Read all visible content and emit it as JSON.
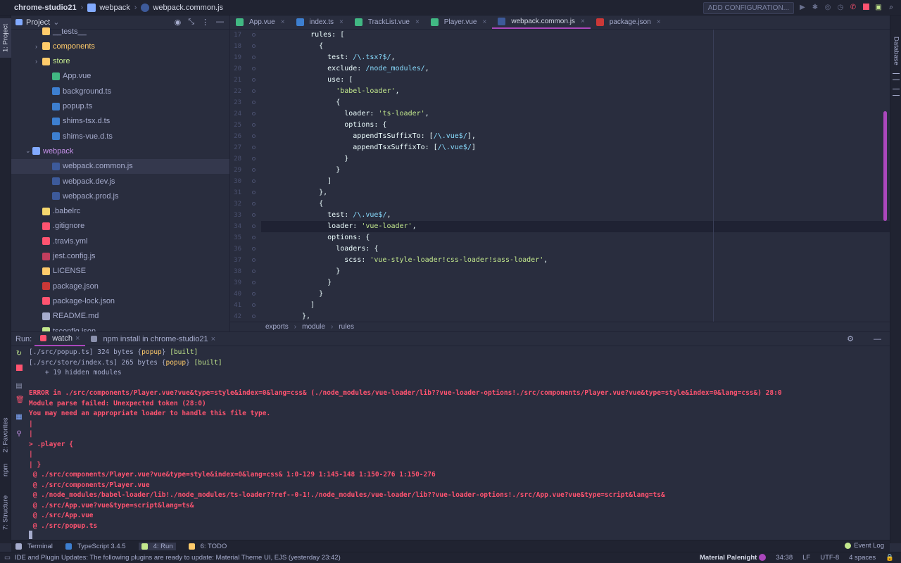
{
  "titlebar": {
    "project": "chrome-studio21",
    "folder": "webpack",
    "file": "webpack.common.js",
    "add_configuration": "ADD CONFIGURATION..."
  },
  "left_strip": {
    "project_tab": "1: Project",
    "favorites_tab": "2: Favorites",
    "npm_tab": "npm",
    "structure_tab": "7: Structure"
  },
  "right_strip": {
    "database_tab": "Database"
  },
  "project_panel": {
    "title": "Project",
    "items": [
      {
        "label": "__tests__",
        "indent": 2,
        "type": "folder",
        "arrow": "",
        "color": "#a6accd"
      },
      {
        "label": "components",
        "indent": 2,
        "type": "folder",
        "arrow": "›",
        "color": "#ffcb6b"
      },
      {
        "label": "store",
        "indent": 2,
        "type": "folder",
        "arrow": "›",
        "color": "#c3e88d"
      },
      {
        "label": "App.vue",
        "indent": 3,
        "type": "vue",
        "arrow": "",
        "color": "#a6accd"
      },
      {
        "label": "background.ts",
        "indent": 3,
        "type": "ts",
        "arrow": "",
        "color": "#a6accd"
      },
      {
        "label": "popup.ts",
        "indent": 3,
        "type": "ts",
        "arrow": "",
        "color": "#a6accd"
      },
      {
        "label": "shims-tsx.d.ts",
        "indent": 3,
        "type": "ts",
        "arrow": "",
        "color": "#a6accd"
      },
      {
        "label": "shims-vue.d.ts",
        "indent": 3,
        "type": "ts",
        "arrow": "",
        "color": "#a6accd"
      },
      {
        "label": "webpack",
        "indent": 1,
        "type": "folder-open",
        "arrow": "⌄",
        "color": "#c792ea"
      },
      {
        "label": "webpack.common.js",
        "indent": 3,
        "type": "js",
        "arrow": "",
        "color": "#a6accd",
        "selected": true
      },
      {
        "label": "webpack.dev.js",
        "indent": 3,
        "type": "js",
        "arrow": "",
        "color": "#a6accd"
      },
      {
        "label": "webpack.prod.js",
        "indent": 3,
        "type": "js",
        "arrow": "",
        "color": "#a6accd"
      },
      {
        "label": ".babelrc",
        "indent": 2,
        "type": "babel",
        "arrow": "",
        "color": "#a6accd"
      },
      {
        "label": ".gitignore",
        "indent": 2,
        "type": "git",
        "arrow": "",
        "color": "#a6accd"
      },
      {
        "label": ".travis.yml",
        "indent": 2,
        "type": "yml",
        "arrow": "",
        "color": "#a6accd"
      },
      {
        "label": "jest.config.js",
        "indent": 2,
        "type": "jest",
        "arrow": "",
        "color": "#a6accd"
      },
      {
        "label": "LICENSE",
        "indent": 2,
        "type": "license",
        "arrow": "",
        "color": "#a6accd"
      },
      {
        "label": "package.json",
        "indent": 2,
        "type": "npm",
        "arrow": "",
        "color": "#a6accd"
      },
      {
        "label": "package-lock.json",
        "indent": 2,
        "type": "lock",
        "arrow": "",
        "color": "#a6accd"
      },
      {
        "label": "README.md",
        "indent": 2,
        "type": "md",
        "arrow": "",
        "color": "#a6accd"
      },
      {
        "label": "tsconfig.json",
        "indent": 2,
        "type": "json",
        "arrow": "",
        "color": "#a6accd"
      }
    ]
  },
  "editor": {
    "tabs": [
      {
        "label": "App.vue",
        "icon": "vue",
        "active": false
      },
      {
        "label": "index.ts",
        "icon": "ts",
        "active": false
      },
      {
        "label": "TrackList.vue",
        "icon": "vue",
        "active": false
      },
      {
        "label": "Player.vue",
        "icon": "vue",
        "active": false
      },
      {
        "label": "webpack.common.js",
        "icon": "js",
        "active": true
      },
      {
        "label": "package.json",
        "icon": "npm",
        "active": false
      }
    ],
    "lines": [
      {
        "n": "17",
        "t": "    rules: ["
      },
      {
        "n": "18",
        "t": "      {"
      },
      {
        "n": "19",
        "t": "        test: /\\.tsx?$/,"
      },
      {
        "n": "20",
        "t": "        exclude: /node_modules/,"
      },
      {
        "n": "21",
        "t": "        use: ["
      },
      {
        "n": "22",
        "t": "          'babel-loader',"
      },
      {
        "n": "23",
        "t": "          {"
      },
      {
        "n": "24",
        "t": "            loader: 'ts-loader',"
      },
      {
        "n": "25",
        "t": "            options: {"
      },
      {
        "n": "26",
        "t": "              appendTsSuffixTo: [/\\.vue$/],"
      },
      {
        "n": "27",
        "t": "              appendTsxSuffixTo: [/\\.vue$/]"
      },
      {
        "n": "28",
        "t": "            }"
      },
      {
        "n": "29",
        "t": "          }"
      },
      {
        "n": "30",
        "t": "        ]"
      },
      {
        "n": "31",
        "t": "      },"
      },
      {
        "n": "32",
        "t": "      {"
      },
      {
        "n": "33",
        "t": "        test: /\\.vue$/,"
      },
      {
        "n": "34",
        "t": "        loader: 'vue-loader',",
        "current": true
      },
      {
        "n": "35",
        "t": "        options: {"
      },
      {
        "n": "36",
        "t": "          loaders: {"
      },
      {
        "n": "37",
        "t": "            scss: 'vue-style-loader!css-loader!sass-loader',"
      },
      {
        "n": "38",
        "t": "          }"
      },
      {
        "n": "39",
        "t": "        }"
      },
      {
        "n": "40",
        "t": "      }"
      },
      {
        "n": "41",
        "t": "    ]"
      },
      {
        "n": "42",
        "t": "  },"
      }
    ],
    "breadcrumb": [
      "exports",
      "module",
      "rules"
    ]
  },
  "run": {
    "label": "Run:",
    "tabs": [
      {
        "label": "watch",
        "active": true
      },
      {
        "label": "npm install in chrome-studio21",
        "active": false
      }
    ],
    "console": [
      {
        "parts": [
          {
            "t": "[./src/popup.ts] 324 bytes {",
            "c": "wh"
          },
          {
            "t": "popup",
            "c": "yl"
          },
          {
            "t": "} ",
            "c": "wh"
          },
          {
            "t": "[built]",
            "c": "gr"
          }
        ]
      },
      {
        "parts": [
          {
            "t": "[./src/store/index.ts] 265 bytes {",
            "c": "wh"
          },
          {
            "t": "popup",
            "c": "yl"
          },
          {
            "t": "} ",
            "c": "wh"
          },
          {
            "t": "[built]",
            "c": "gr"
          }
        ]
      },
      {
        "parts": [
          {
            "t": "    + 19 hidden modules",
            "c": "wh"
          }
        ]
      },
      {
        "parts": [
          {
            "t": "",
            "c": "wh"
          }
        ]
      },
      {
        "parts": [
          {
            "t": "ERROR in ./src/components/Player.vue?vue&type=style&index=0&lang=css& (./node_modules/vue-loader/lib??vue-loader-options!./src/components/Player.vue?vue&type=style&index=0&lang=css&) 28:0",
            "c": "err"
          }
        ]
      },
      {
        "parts": [
          {
            "t": "Module parse failed: Unexpected token (28:0)",
            "c": "err"
          }
        ]
      },
      {
        "parts": [
          {
            "t": "You may need an appropriate loader to handle this file type.",
            "c": "err"
          }
        ]
      },
      {
        "parts": [
          {
            "t": "|",
            "c": "err"
          }
        ]
      },
      {
        "parts": [
          {
            "t": "|",
            "c": "err"
          }
        ]
      },
      {
        "parts": [
          {
            "t": "> .player {",
            "c": "err"
          }
        ]
      },
      {
        "parts": [
          {
            "t": "|",
            "c": "err"
          }
        ]
      },
      {
        "parts": [
          {
            "t": "| }",
            "c": "err"
          }
        ]
      },
      {
        "parts": [
          {
            "t": " @ ./src/components/Player.vue?vue&type=style&index=0&lang=css& 1:0-129 1:145-148 1:150-276 1:150-276",
            "c": "err"
          }
        ]
      },
      {
        "parts": [
          {
            "t": " @ ./src/components/Player.vue",
            "c": "err"
          }
        ]
      },
      {
        "parts": [
          {
            "t": " @ ./node_modules/babel-loader/lib!./node_modules/ts-loader??ref--0-1!./node_modules/vue-loader/lib??vue-loader-options!./src/App.vue?vue&type=script&lang=ts&",
            "c": "err"
          }
        ]
      },
      {
        "parts": [
          {
            "t": " @ ./src/App.vue?vue&type=script&lang=ts&",
            "c": "err"
          }
        ]
      },
      {
        "parts": [
          {
            "t": " @ ./src/App.vue",
            "c": "err"
          }
        ]
      },
      {
        "parts": [
          {
            "t": " @ ./src/popup.ts",
            "c": "err"
          }
        ]
      }
    ]
  },
  "tool_windows": [
    {
      "label": "Terminal",
      "icon": "terminal-icon"
    },
    {
      "label": "TypeScript 3.4.5",
      "icon": "typescript-icon"
    },
    {
      "label": "4: Run",
      "icon": "run-icon"
    },
    {
      "label": "6: TODO",
      "icon": "todo-icon"
    }
  ],
  "event_log": "Event Log",
  "status": {
    "message": "IDE and Plugin Updates: The following plugins are ready to update: Material Theme UI, EJS (yesterday 23:42)",
    "theme": "Material Palenight",
    "position": "34:38",
    "line_sep": "LF",
    "encoding": "UTF-8",
    "indent": "4 spaces"
  },
  "colors": {
    "accent": "#ab47bc",
    "error": "#ff5370",
    "string": "#c3e88d",
    "regex": "#89ddff",
    "bg": "#292d3e"
  }
}
